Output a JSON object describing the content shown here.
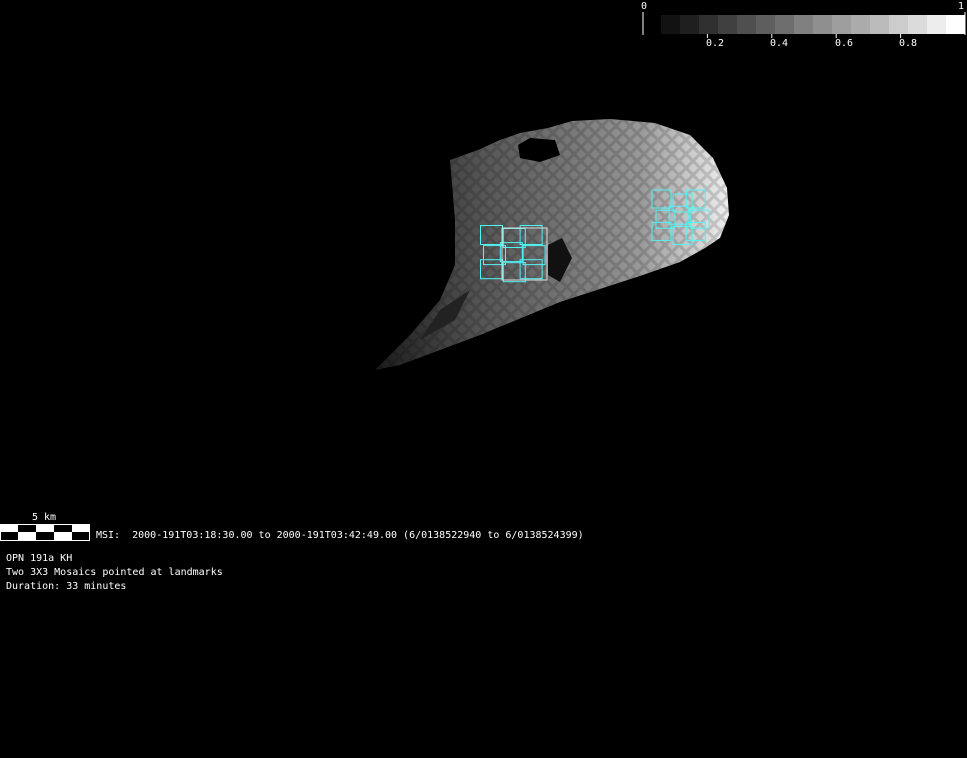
{
  "colorbar": {
    "min_label": "0",
    "max_label": "1",
    "tick_labels": [
      "0.2",
      "0.4",
      "0.6",
      "0.8"
    ],
    "tick_values": [
      0.2,
      0.4,
      0.6,
      0.8
    ],
    "levels": [
      0.07,
      0.12,
      0.19,
      0.25,
      0.31,
      0.37,
      0.43,
      0.5,
      0.56,
      0.62,
      0.67,
      0.73,
      0.8,
      0.86,
      0.93,
      1.0
    ]
  },
  "scale_bar": {
    "label": "5 km"
  },
  "info": {
    "msi_line": "MSI:  2000-191T03:18:30.00 to 2000-191T03:42:49.00 (6/0138522940 to 6/0138524399)",
    "opn": "OPN 191a KH",
    "description": "Two 3X3 Mosaics pointed at landmarks",
    "duration": "Duration: 33 minutes"
  },
  "colors": {
    "footprint": "#4ff4f4",
    "background": "#000000"
  }
}
